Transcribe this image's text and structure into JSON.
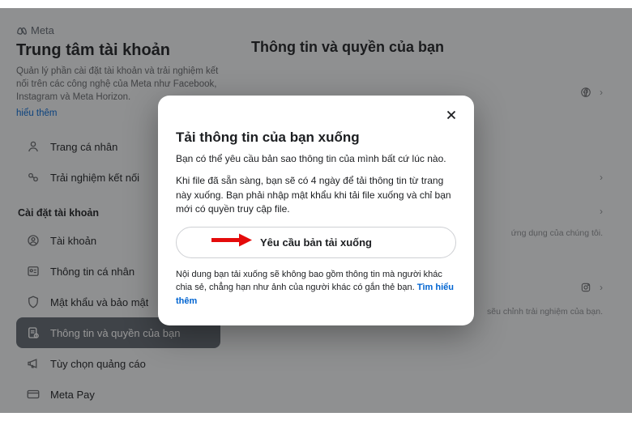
{
  "brand": {
    "name": "Meta"
  },
  "sidebar": {
    "title": "Trung tâm tài khoản",
    "description": "Quản lý phần cài đặt tài khoản và trải nghiệm kết nối trên các công nghệ của Meta như Facebook, Instagram và Meta Horizon.",
    "learn_more": "hiểu thêm",
    "items_top": [
      {
        "label": "Trang cá nhân"
      },
      {
        "label": "Trải nghiệm kết nối"
      }
    ],
    "section_label": "Cài đặt tài khoản",
    "items": [
      {
        "label": "Tài khoản"
      },
      {
        "label": "Thông tin cá nhân"
      },
      {
        "label": "Mật khẩu và bảo mật"
      },
      {
        "label": "Thông tin và quyền của bạn"
      },
      {
        "label": "Tùy chọn quảng cáo"
      },
      {
        "label": "Meta Pay"
      }
    ]
  },
  "main": {
    "title": "Thông tin và quyền của bạn",
    "rows": {
      "r1_sub": "ứng dụng của chúng tôi.",
      "r2_sub": "sẽu chỉnh trải nghiệm của bạn."
    }
  },
  "modal": {
    "title": "Tải thông tin của bạn xuống",
    "p1": "Bạn có thể yêu cầu bản sao thông tin của mình bất cứ lúc nào.",
    "p2": "Khi file đã sẵn sàng, bạn sẽ có 4 ngày để tải thông tin từ trang này xuống. Bạn phải nhập mật khẩu khi tải file xuống và chỉ bạn mới có quyền truy cập file.",
    "cta": "Yêu cầu bản tải xuống",
    "footer_text": "Nội dung bạn tải xuống sẽ không bao gồm thông tin mà người khác chia sẻ, chẳng hạn như ảnh của người khác có gắn thẻ bạn.",
    "footer_link": "Tìm hiểu thêm"
  }
}
